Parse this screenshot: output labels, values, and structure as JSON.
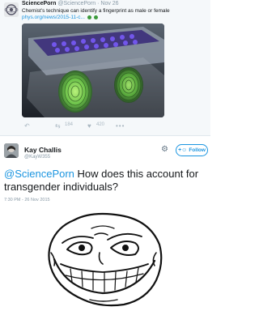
{
  "top_tweet": {
    "name": "SciencePorn",
    "handle_date": "@SciencePorn · Nov 26",
    "text": "Chemist's technique can identify a fingerprint as male or female",
    "link": "phys.org/news/2015-11-c...",
    "retweets": "184",
    "likes": "420"
  },
  "reply_tweet": {
    "name": "Kay Challis",
    "handle": "@KayW355",
    "follow_label": "Follow",
    "mention": "@SciencePorn",
    "text": " How does this account for transgender individuals?",
    "timestamp": "7:30 PM - 26 Nov 2015"
  },
  "icons": {
    "reply": "reply-icon",
    "retweet": "retweet-icon",
    "like": "heart-icon",
    "more": "more-icon",
    "settings": "gear-icon",
    "follow": "add-user-icon"
  },
  "colors": {
    "link_blue": "#1b95e0",
    "muted_gray": "#8899a6",
    "card_bg": "#f5f8fa"
  }
}
